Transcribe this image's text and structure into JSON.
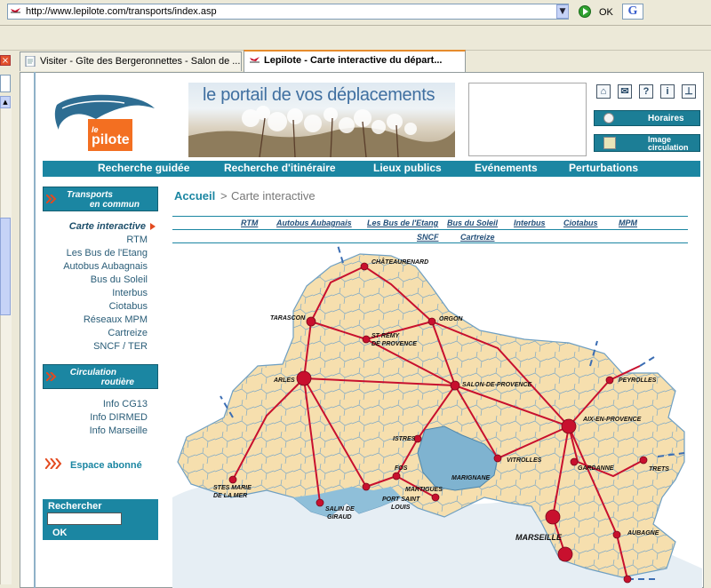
{
  "browser": {
    "url": "http://www.lepilote.com/transports/index.asp",
    "go_label": "OK",
    "search_engine_glyph": "G",
    "tabs": [
      {
        "label": "Visiter - Gîte des Bergeronnettes - Salon de ...",
        "active": false
      },
      {
        "label": "Lepilote - Carte interactive du départ...",
        "active": true
      }
    ]
  },
  "header": {
    "logo_le": "le",
    "logo_text": "pilote",
    "banner_title": "le portail de vos déplacements",
    "icons": [
      "home-icon",
      "mail-icon",
      "help-icon",
      "info-icon",
      "sitemap-icon"
    ],
    "buttons": {
      "horaires": "Horaires",
      "image_line1": "Image",
      "image_line2": "circulation"
    }
  },
  "nav": [
    "Recherche guidée",
    "Recherche d'itinéraire",
    "Lieux publics",
    "Evénements",
    "Perturbations"
  ],
  "sidebar": {
    "section1_line1": "Transports",
    "section1_line2": "en commun",
    "links1": [
      "Carte interactive",
      "RTM",
      "Les Bus de l'Etang",
      "Autobus Aubagnais",
      "Bus du Soleil",
      "Interbus",
      "Ciotabus",
      "Réseaux MPM",
      "Cartreize",
      "SNCF / TER"
    ],
    "section2_line1": "Circulation",
    "section2_line2": "routière",
    "links2": [
      "Info CG13",
      "Info DIRMED",
      "Info Marseille"
    ],
    "espace": "Espace abonné",
    "search_label": "Rechercher",
    "search_ok": "OK"
  },
  "breadcrumb": {
    "home": "Accueil",
    "separator": ">",
    "current": "Carte interactive"
  },
  "operators_row1": [
    "RTM",
    "Autobus Aubagnais",
    "Les Bus de l'Etang",
    "Bus du Soleil",
    "Interbus",
    "Ciotabus",
    "MPM"
  ],
  "operators_row2": [
    "SNCF",
    "Cartreize"
  ],
  "map": {
    "cities": [
      "CHÂTEAURENARD",
      "TARASCON",
      "ORGON",
      "ST RÉMY",
      "DE PROVENCE",
      "ARLES",
      "SALON-DE-PROVENCE",
      "PEYROLLES",
      "AIX-EN-PROVENCE",
      "ISTRES",
      "FOS",
      "MARTIGUES",
      "MARIGNANE",
      "VITROLLES",
      "GARDANNE",
      "TRETS",
      "STES MARIE",
      "DE LA MER",
      "SALIN DE",
      "GIRAUD",
      "PORT SAINT",
      "LOUIS",
      "MARSEILLE",
      "AUBAGNE"
    ],
    "colors": {
      "land": "#f6dfae",
      "water": "#7fb3d0",
      "route": "#c8102e",
      "commune_border": "#7aa7c7"
    }
  },
  "colors": {
    "teal": "#1b86a2",
    "orange": "#f36f21"
  }
}
